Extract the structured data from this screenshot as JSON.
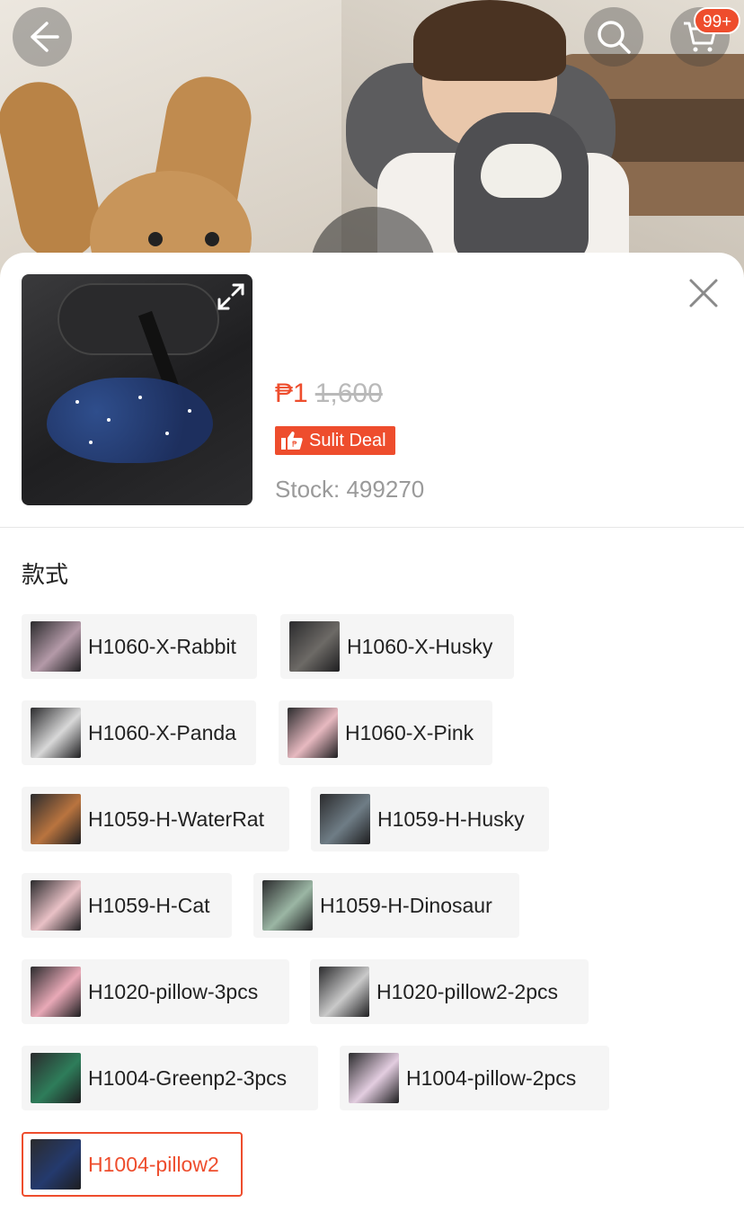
{
  "header": {
    "cart_badge": "99+"
  },
  "product": {
    "price_current": "₱1",
    "price_original": "1,600",
    "deal_label": "Sulit Deal",
    "stock_text": "Stock: 499270"
  },
  "variations": {
    "title": "款式",
    "options": [
      {
        "label": "H1060-X-Rabbit",
        "thumb": "#b49aa8"
      },
      {
        "label": "H1060-X-Husky",
        "thumb": "#6d6a66"
      },
      {
        "label": "H1060-X-Panda",
        "thumb": "#d8d8d8"
      },
      {
        "label": "H1060-X-Pink",
        "thumb": "#e7b9c0"
      },
      {
        "label": "H1059-H-WaterRat",
        "thumb": "#b9743f"
      },
      {
        "label": "H1059-H-Husky",
        "thumb": "#6f7d86"
      },
      {
        "label": "H1059-H-Cat",
        "thumb": "#e9c1c6"
      },
      {
        "label": "H1059-H-Dinosaur",
        "thumb": "#9bb6a4"
      },
      {
        "label": "H1020-pillow-3pcs",
        "thumb": "#e9a9b7"
      },
      {
        "label": "H1020-pillow2-2pcs",
        "thumb": "#c9c9c9"
      },
      {
        "label": "H1004-Greenp2-3pcs",
        "thumb": "#2e7d5a"
      },
      {
        "label": "H1004-pillow-2pcs",
        "thumb": "#e3cde0"
      },
      {
        "label": "H1004-pillow2",
        "thumb": "#243a6e",
        "selected": true
      }
    ]
  },
  "colors": {
    "accent": "#ee4d2d",
    "muted_text": "#9a9a9a"
  }
}
